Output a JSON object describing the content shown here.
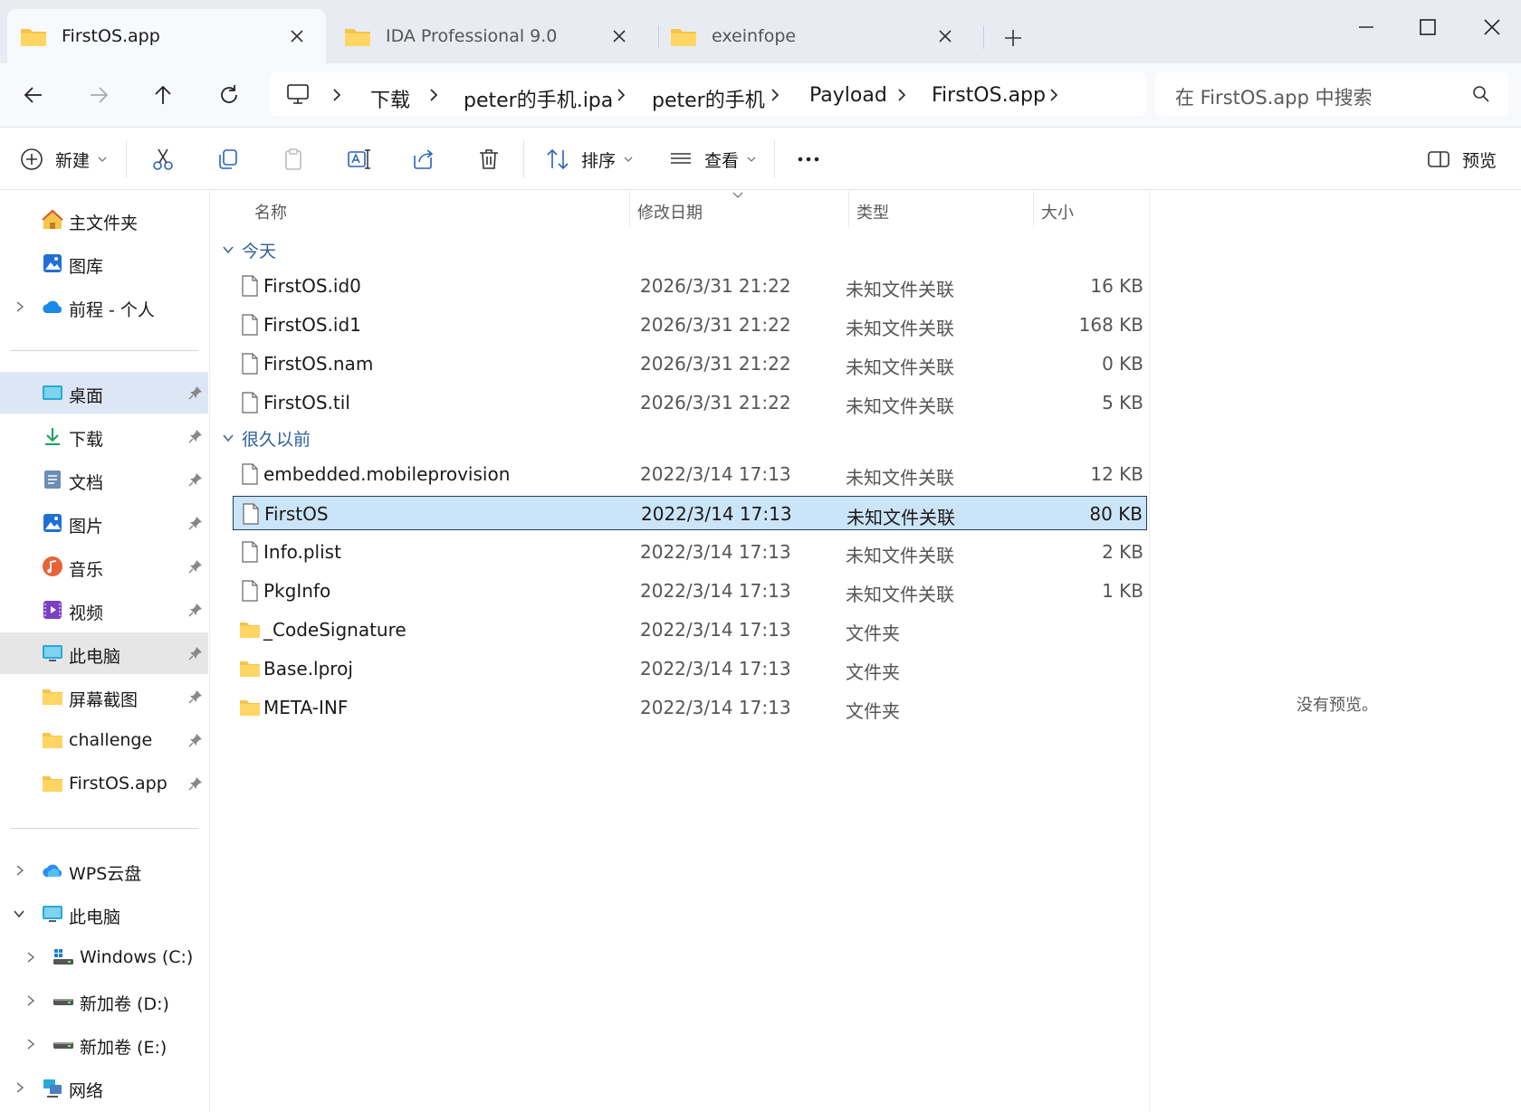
{
  "tabs": [
    {
      "label": "FirstOS.app",
      "active": true
    },
    {
      "label": "IDA Professional 9.0",
      "active": false
    },
    {
      "label": "exeinfope",
      "active": false
    }
  ],
  "breadcrumbs": [
    "下载",
    "peter的手机.ipa",
    "peter的手机",
    "Payload",
    "FirstOS.app"
  ],
  "search": {
    "placeholder": "在 FirstOS.app 中搜索"
  },
  "toolbar": {
    "new_label": "新建",
    "sort_label": "排序",
    "view_label": "查看",
    "preview_label": "预览"
  },
  "sidebar": {
    "quick": [
      {
        "label": "主文件夹",
        "icon": "home-icon"
      },
      {
        "label": "图库",
        "icon": "gallery-icon"
      },
      {
        "label": "前程 - 个人",
        "icon": "onedrive-icon"
      }
    ],
    "pinned": [
      {
        "label": "桌面",
        "icon": "desktop-icon"
      },
      {
        "label": "下载",
        "icon": "download-icon"
      },
      {
        "label": "文档",
        "icon": "documents-icon"
      },
      {
        "label": "图片",
        "icon": "pictures-icon"
      },
      {
        "label": "音乐",
        "icon": "music-icon"
      },
      {
        "label": "视频",
        "icon": "videos-icon"
      },
      {
        "label": "此电脑",
        "icon": "pc-icon"
      },
      {
        "label": "屏幕截图",
        "icon": "folder-icon"
      },
      {
        "label": "challenge",
        "icon": "folder-icon"
      },
      {
        "label": "FirstOS.app",
        "icon": "folder-icon"
      }
    ],
    "tree": [
      {
        "label": "WPS云盘",
        "icon": "cloud-icon"
      },
      {
        "label": "此电脑",
        "icon": "pc-icon"
      },
      {
        "label": "Windows (C:)",
        "icon": "windows-drive-icon"
      },
      {
        "label": "新加卷 (D:)",
        "icon": "drive-icon"
      },
      {
        "label": "新加卷 (E:)",
        "icon": "drive-icon"
      },
      {
        "label": "网络",
        "icon": "network-icon"
      }
    ]
  },
  "columns": {
    "name": "名称",
    "modified": "修改日期",
    "type": "类型",
    "size": "大小"
  },
  "groups": [
    {
      "label": "今天",
      "files": [
        {
          "name": "FirstOS.id0",
          "modified": "2026/3/31 21:22",
          "type": "未知文件关联",
          "size": "16 KB",
          "kind": "file"
        },
        {
          "name": "FirstOS.id1",
          "modified": "2026/3/31 21:22",
          "type": "未知文件关联",
          "size": "168 KB",
          "kind": "file"
        },
        {
          "name": "FirstOS.nam",
          "modified": "2026/3/31 21:22",
          "type": "未知文件关联",
          "size": "0 KB",
          "kind": "file"
        },
        {
          "name": "FirstOS.til",
          "modified": "2026/3/31 21:22",
          "type": "未知文件关联",
          "size": "5 KB",
          "kind": "file"
        }
      ]
    },
    {
      "label": "很久以前",
      "files": [
        {
          "name": "embedded.mobileprovision",
          "modified": "2022/3/14 17:13",
          "type": "未知文件关联",
          "size": "12 KB",
          "kind": "file"
        },
        {
          "name": "FirstOS",
          "modified": "2022/3/14 17:13",
          "type": "未知文件关联",
          "size": "80 KB",
          "kind": "file",
          "selected": true
        },
        {
          "name": "Info.plist",
          "modified": "2022/3/14 17:13",
          "type": "未知文件关联",
          "size": "2 KB",
          "kind": "file"
        },
        {
          "name": "PkgInfo",
          "modified": "2022/3/14 17:13",
          "type": "未知文件关联",
          "size": "1 KB",
          "kind": "file"
        },
        {
          "name": "_CodeSignature",
          "modified": "2022/3/14 17:13",
          "type": "文件夹",
          "size": "",
          "kind": "folder"
        },
        {
          "name": "Base.lproj",
          "modified": "2022/3/14 17:13",
          "type": "文件夹",
          "size": "",
          "kind": "folder"
        },
        {
          "name": "META-INF",
          "modified": "2022/3/14 17:13",
          "type": "文件夹",
          "size": "",
          "kind": "folder"
        }
      ]
    }
  ],
  "preview": {
    "message": "没有预览。"
  },
  "colors": {
    "accent": "#1c3d6a",
    "selection": "#cce4f7",
    "folder": "#f4c54a",
    "group_text": "#2f5d9e"
  }
}
